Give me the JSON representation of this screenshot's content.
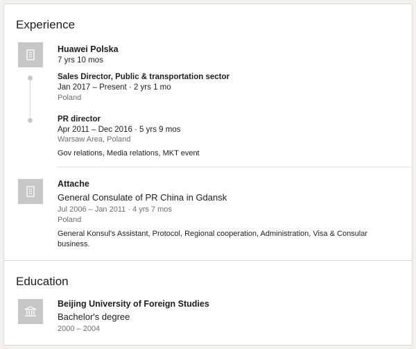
{
  "experience": {
    "title": "Experience",
    "companies": [
      {
        "name": "Huawei Polska",
        "total_duration": "7 yrs 10 mos",
        "logo_icon": "building-icon",
        "roles": [
          {
            "title": "Sales Director, Public & transportation sector",
            "dates": "Jan 2017 – Present · 2 yrs 1 mo",
            "location": "Poland"
          },
          {
            "title": "PR director",
            "dates": "Apr 2011 – Dec 2016 · 5 yrs 9 mos",
            "location": "Warsaw Area, Poland",
            "description": "Gov relations, Media relations, MKT event"
          }
        ]
      },
      {
        "title": "Attache",
        "company": "General Consulate of PR China in Gdansk",
        "dates": "Jul 2006 – Jan 2011 · 4 yrs 7 mos",
        "location": "Poland",
        "description": "General Konsul's Assistant, Protocol, Regional cooperation, Administration, Visa & Consular business.",
        "logo_icon": "building-icon"
      }
    ]
  },
  "education": {
    "title": "Education",
    "items": [
      {
        "school": "Beijing University of Foreign Studies",
        "degree": "Bachelor's degree",
        "dates": "2000 – 2004",
        "logo_icon": "school-icon"
      }
    ]
  },
  "colors": {
    "logo_bg": "#c7c7c7",
    "text_primary": "#1d1d1d",
    "text_secondary": "#6e6e6e",
    "divider": "#dadada"
  }
}
